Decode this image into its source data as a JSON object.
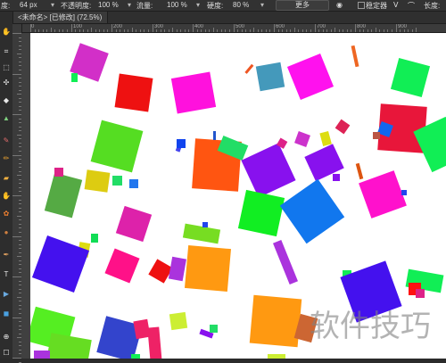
{
  "options_bar": {
    "size_label": "度:",
    "size_value": "64 px",
    "opacity_label": "不透明度:",
    "opacity_value": "100 %",
    "flow_label": "流量:",
    "flow_value": "100 %",
    "hardness_label": "硬度:",
    "hardness_value": "80 %",
    "more_button": "更多",
    "stabilizer_label": "稳定器",
    "length_label": "长度:"
  },
  "document_tab": {
    "title": "<未命名> [已修改] (72.5%)"
  },
  "ruler": {
    "top_labels": [
      "0",
      "100",
      "200",
      "300",
      "400",
      "500",
      "600",
      "700",
      "800",
      "900"
    ]
  },
  "toolbar": {
    "tools": [
      "move-tool-icon",
      "crop-tool-icon",
      "selection-tool-icon",
      "lasso-tool-icon",
      "flood-fill-icon",
      "gradient-tool-icon",
      "brush-tool-icon",
      "pencil-tool-icon",
      "eraser-tool-icon",
      "smudge-tool-icon",
      "clone-tool-icon",
      "dodge-tool-icon",
      "pen-tool-icon",
      "text-tool-icon",
      "shape-tool-icon",
      "zoom-tool-icon",
      "color-swatch-icon"
    ]
  },
  "colors": {
    "app_bg": "#2b2b2b",
    "panel_bg": "#323232",
    "canvas_bg": "#ffffff"
  },
  "watermark": "软件技巧"
}
